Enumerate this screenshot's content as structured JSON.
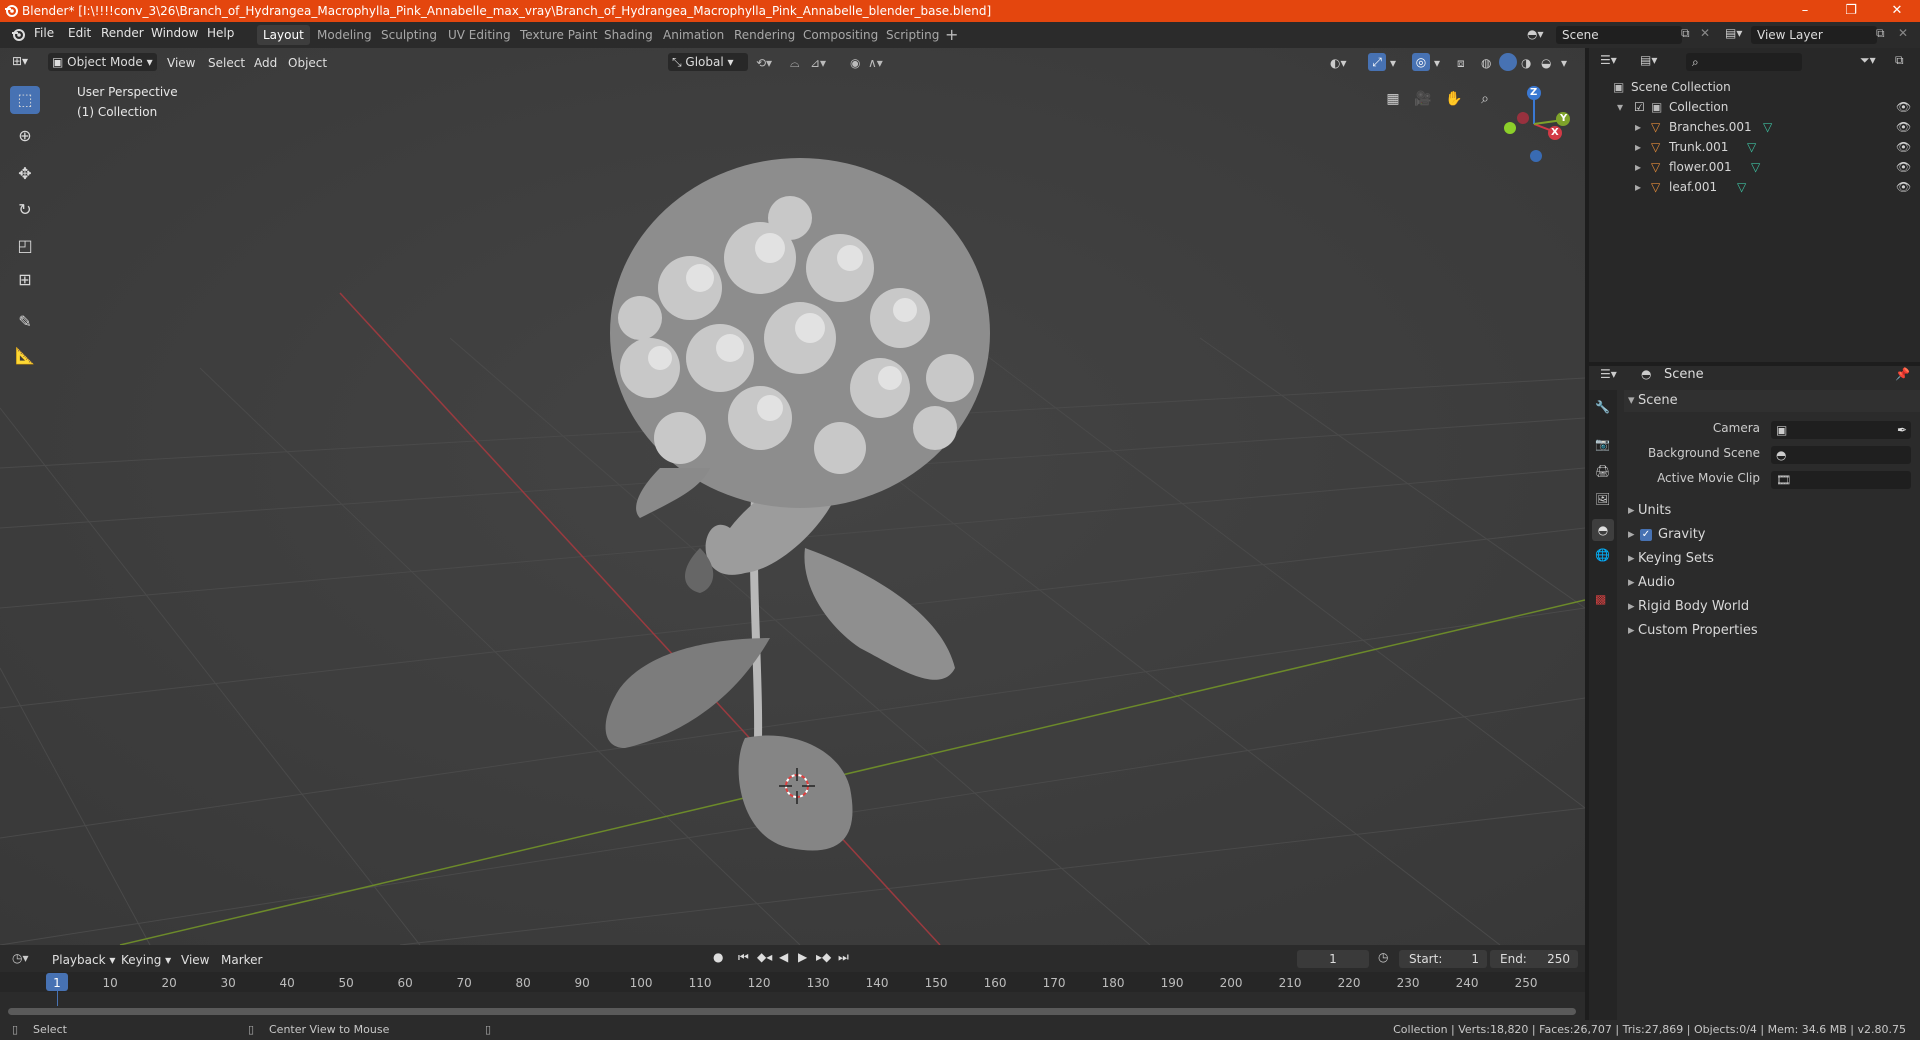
{
  "titlebar": {
    "title": "Blender* [I:\\!!!!conv_3\\26\\Branch_of_Hydrangea_Macrophylla_Pink_Annabelle_max_vray\\Branch_of_Hydrangea_Macrophylla_Pink_Annabelle_blender_base.blend]",
    "min": "–",
    "max": "❐",
    "close": "✕"
  },
  "menu": {
    "file": "File",
    "edit": "Edit",
    "render": "Render",
    "window": "Window",
    "help": "Help"
  },
  "workspaces": [
    "Layout",
    "Modeling",
    "Sculpting",
    "UV Editing",
    "Texture Paint",
    "Shading",
    "Animation",
    "Rendering",
    "Compositing",
    "Scripting"
  ],
  "scene_field": "Scene",
  "viewlayer_field": "View Layer",
  "viewport": {
    "mode": "Object Mode",
    "menus": {
      "view": "View",
      "select": "Select",
      "add": "Add",
      "object": "Object"
    },
    "orientation": "Global",
    "overlay_line1": "User Perspective",
    "overlay_line2": "(1) Collection",
    "gizmo": {
      "x": "X",
      "y": "Y",
      "z": "Z"
    }
  },
  "outliner": {
    "root": "Scene Collection",
    "collection": "Collection",
    "objects": [
      "Branches.001",
      "Trunk.001",
      "flower.001",
      "leaf.001"
    ]
  },
  "properties": {
    "header": "Scene",
    "section": "Scene",
    "camera_label": "Camera",
    "bg_scene_label": "Background Scene",
    "movie_clip_label": "Active Movie Clip",
    "panels": [
      "Units",
      "Gravity",
      "Keying Sets",
      "Audio",
      "Rigid Body World",
      "Custom Properties"
    ]
  },
  "timeline": {
    "menus": {
      "playback": "Playback",
      "keying": "Keying",
      "view": "View",
      "marker": "Marker"
    },
    "current_frame": "1",
    "start_label": "Start:",
    "start_value": "1",
    "end_label": "End:",
    "end_value": "250",
    "ticks": [
      "1",
      "10",
      "20",
      "30",
      "40",
      "50",
      "60",
      "70",
      "80",
      "90",
      "100",
      "110",
      "120",
      "130",
      "140",
      "150",
      "160",
      "170",
      "180",
      "190",
      "200",
      "210",
      "220",
      "230",
      "240",
      "250"
    ]
  },
  "statusbar": {
    "left1": "Select",
    "left2": "Center View to Mouse",
    "stats": "Collection | Verts:18,820 | Faces:26,707 | Tris:27,869 | Objects:0/4 | Mem: 34.6 MB | v2.80.75"
  },
  "colors": {
    "accent": "#4772b3",
    "titlebar": "#e4460e",
    "x_axis": "#c1323c",
    "y_axis": "#7ea22a"
  }
}
